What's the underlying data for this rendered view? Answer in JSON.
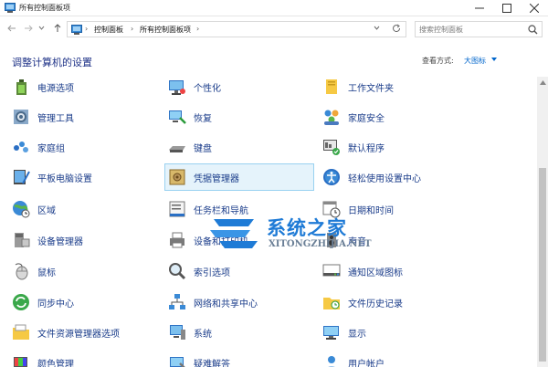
{
  "window": {
    "title": "所有控制面板项"
  },
  "address": {
    "crumbs": [
      "控制面板",
      "所有控制面板项"
    ],
    "search_placeholder": "搜索控制面板"
  },
  "header": {
    "title": "调整计算机的设置",
    "view_by_label": "查看方式:",
    "view_by_value": "大图标"
  },
  "items": [
    [
      "电源选项",
      "个性化",
      "工作文件夹"
    ],
    [
      "管理工具",
      "恢复",
      "家庭安全"
    ],
    [
      "家庭组",
      "键盘",
      "默认程序"
    ],
    [
      "平板电脑设置",
      "凭据管理器",
      "轻松使用设置中心"
    ],
    [
      "区域",
      "任务栏和导航",
      "日期和时间"
    ],
    [
      "设备管理器",
      "设备和打印机",
      "声音"
    ],
    [
      "鼠标",
      "索引选项",
      "通知区域图标"
    ],
    [
      "同步中心",
      "网络和共享中心",
      "文件历史记录"
    ],
    [
      "文件资源管理器选项",
      "系统",
      "显示"
    ],
    [
      "颜色管理",
      "疑难解答",
      "用户帐户"
    ]
  ],
  "selected_item": "凭据管理器",
  "watermark": {
    "text": "系统之家",
    "url": "XITONGZHIJIA.NET"
  },
  "colors": {
    "link": "#1a3c8a",
    "title": "#1e3287",
    "accent": "#0066cc",
    "selection": "#e5f3fb"
  }
}
